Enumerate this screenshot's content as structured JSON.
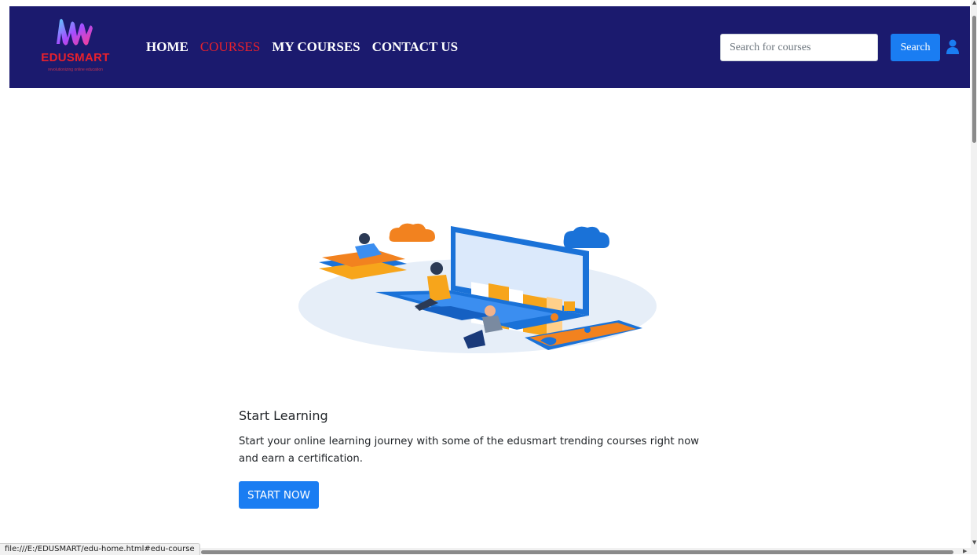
{
  "brand": {
    "name": "EDUSMART",
    "tagline": "revolutionizing online education"
  },
  "nav": {
    "items": [
      {
        "label": "HOME",
        "active": false
      },
      {
        "label": "COURSES",
        "active": true
      },
      {
        "label": "MY COURSES",
        "active": false
      },
      {
        "label": "CONTACT US",
        "active": false
      }
    ]
  },
  "search": {
    "placeholder": "Search for courses",
    "value": "",
    "button_label": "Search"
  },
  "hero": {
    "heading": "Start Learning",
    "description": "Start your online learning journey with some of the edusmart trending courses right now and earn a certification.",
    "button_label": "START NOW"
  },
  "status_bar": {
    "url": "file:///E:/EDUSMART/edu-home.html#edu-course"
  },
  "colors": {
    "navbar_bg": "#1b1a6e",
    "accent": "#1a7df2",
    "active_link": "#e8212c"
  },
  "icons": {
    "user": "user-icon",
    "logo": "edusmart-logo-mark"
  }
}
